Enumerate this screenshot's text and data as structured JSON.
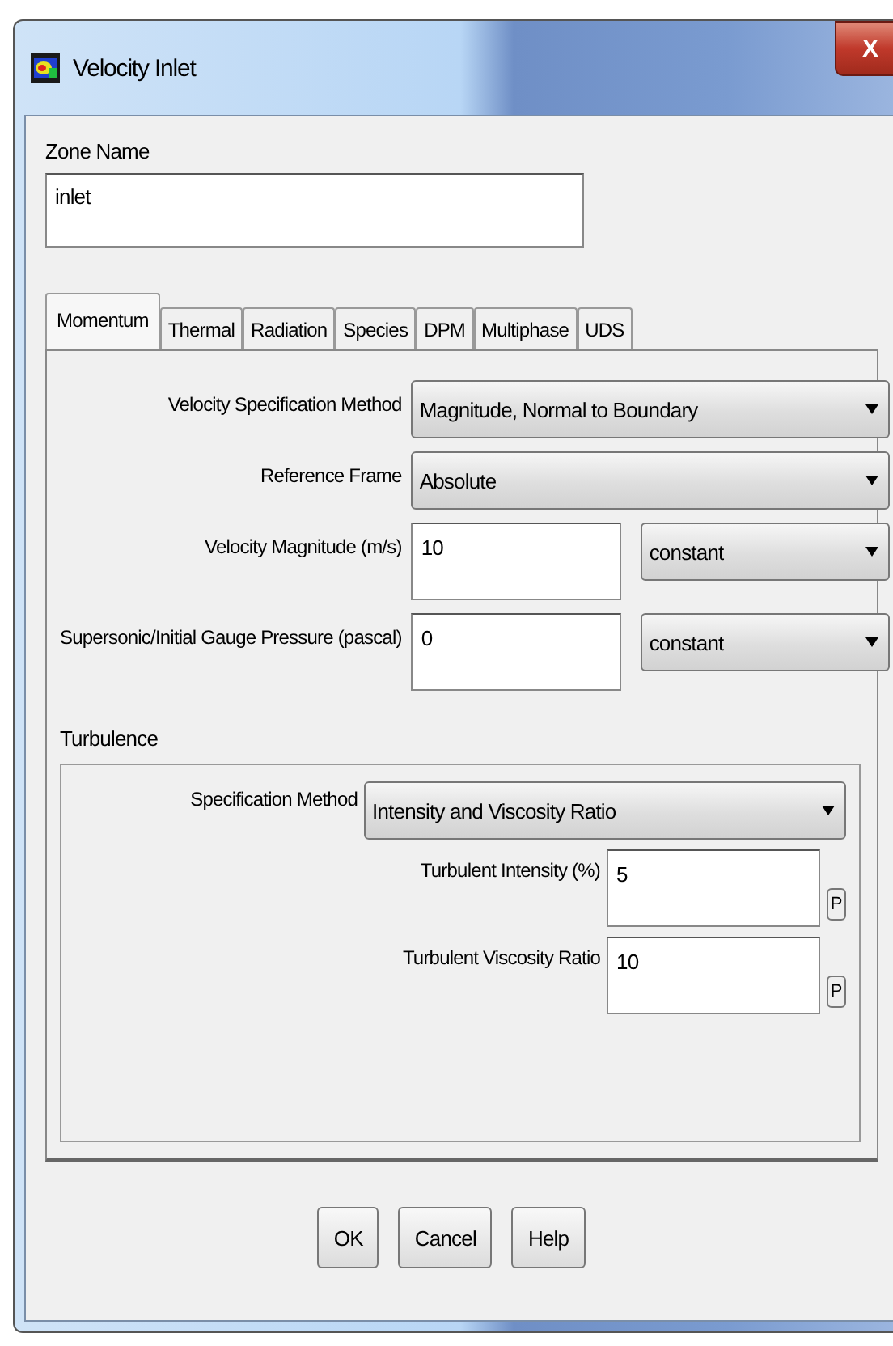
{
  "window": {
    "title": "Velocity Inlet",
    "close_button": "X"
  },
  "zone_name": {
    "label": "Zone Name",
    "value": "inlet"
  },
  "tabs": [
    {
      "label": "Momentum",
      "selected": true
    },
    {
      "label": "Thermal",
      "selected": false
    },
    {
      "label": "Radiation",
      "selected": false
    },
    {
      "label": "Species",
      "selected": false
    },
    {
      "label": "DPM",
      "selected": false
    },
    {
      "label": "Multiphase",
      "selected": false
    },
    {
      "label": "UDS",
      "selected": false
    }
  ],
  "momentum": [
    {
      "kind": "dropdown",
      "label": "Velocity Specification Method",
      "value": "Magnitude, Normal to Boundary"
    },
    {
      "kind": "dropdown",
      "label": "Reference Frame",
      "value": "Absolute"
    },
    {
      "kind": "input",
      "label": "Velocity Magnitude (m/s)",
      "value": "10",
      "profile": "constant"
    },
    {
      "kind": "input",
      "label": "Supersonic/Initial Gauge Pressure (pascal)",
      "value": "0",
      "profile": "constant"
    }
  ],
  "turbulence": {
    "title": "Turbulence",
    "method": {
      "label": "Specification Method",
      "value": "Intensity and Viscosity Ratio"
    },
    "fields": [
      {
        "label": "Turbulent Intensity (%)",
        "value": "5",
        "parameter_button": "P"
      },
      {
        "label": "Turbulent Viscosity Ratio",
        "value": "10",
        "parameter_button": "P"
      }
    ]
  },
  "buttons": [
    "OK",
    "Cancel",
    "Help"
  ]
}
